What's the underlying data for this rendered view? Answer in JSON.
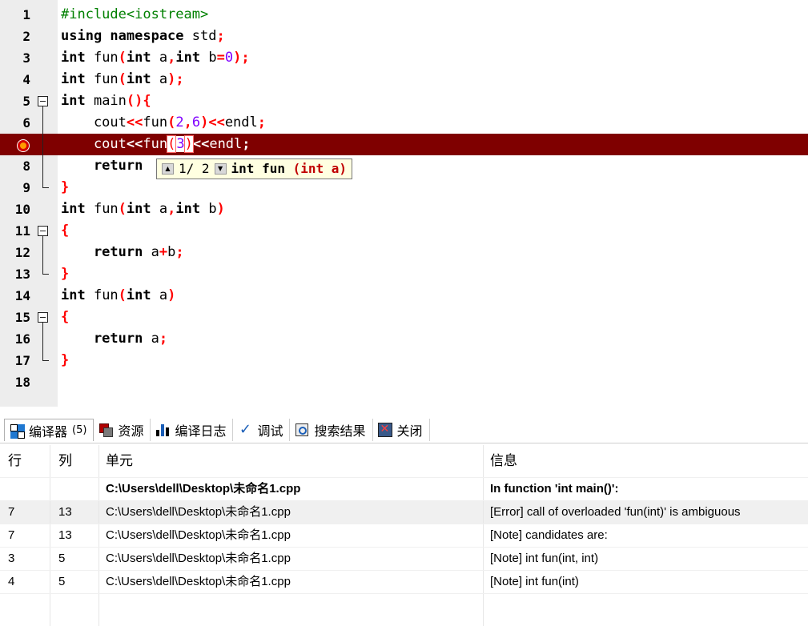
{
  "editor": {
    "lines": [
      {
        "num": "1",
        "fold": "",
        "tokens": [
          {
            "t": "#include<iostream>",
            "c": "pp"
          }
        ]
      },
      {
        "num": "2",
        "fold": "",
        "tokens": [
          {
            "t": "using namespace",
            "c": "kw"
          },
          {
            "t": " std",
            "c": ""
          },
          {
            "t": ";",
            "c": "sym"
          }
        ]
      },
      {
        "num": "3",
        "fold": "",
        "tokens": [
          {
            "t": "int",
            "c": "kw"
          },
          {
            "t": " fun",
            "c": ""
          },
          {
            "t": "(",
            "c": "sym"
          },
          {
            "t": "int",
            "c": "kw"
          },
          {
            "t": " a",
            "c": ""
          },
          {
            "t": ",",
            "c": "sym"
          },
          {
            "t": "int",
            "c": "kw"
          },
          {
            "t": " b",
            "c": ""
          },
          {
            "t": "=",
            "c": "sym"
          },
          {
            "t": "0",
            "c": "num"
          },
          {
            "t": ");",
            "c": "sym"
          }
        ]
      },
      {
        "num": "4",
        "fold": "",
        "tokens": [
          {
            "t": "int",
            "c": "kw"
          },
          {
            "t": " fun",
            "c": ""
          },
          {
            "t": "(",
            "c": "sym"
          },
          {
            "t": "int",
            "c": "kw"
          },
          {
            "t": " a",
            "c": ""
          },
          {
            "t": ");",
            "c": "sym"
          }
        ]
      },
      {
        "num": "5",
        "fold": "start",
        "tokens": [
          {
            "t": "int",
            "c": "kw"
          },
          {
            "t": " main",
            "c": ""
          },
          {
            "t": "(){",
            "c": "sym"
          }
        ]
      },
      {
        "num": "6",
        "fold": "mid",
        "tokens": [
          {
            "t": "    cout",
            "c": ""
          },
          {
            "t": "<<",
            "c": "sym"
          },
          {
            "t": "fun",
            "c": ""
          },
          {
            "t": "(",
            "c": "sym"
          },
          {
            "t": "2",
            "c": "num"
          },
          {
            "t": ",",
            "c": "sym"
          },
          {
            "t": "6",
            "c": "num"
          },
          {
            "t": ")<<",
            "c": "sym"
          },
          {
            "t": "endl",
            "c": ""
          },
          {
            "t": ";",
            "c": "sym"
          }
        ]
      },
      {
        "num": "7",
        "fold": "mid",
        "breakpoint": true,
        "tokens": [
          {
            "t": "    cout",
            "c": ""
          },
          {
            "t": "<<",
            "c": "sym"
          },
          {
            "t": "fun",
            "c": ""
          },
          {
            "t": "(",
            "c": "hl-br"
          },
          {
            "t": "3",
            "c": "cursor"
          },
          {
            "t": ")",
            "c": "hl-br"
          },
          {
            "t": "<<",
            "c": "sym"
          },
          {
            "t": "endl",
            "c": ""
          },
          {
            "t": ";",
            "c": "sym"
          }
        ]
      },
      {
        "num": "8",
        "fold": "mid",
        "tokens": [
          {
            "t": "    return",
            "c": "kw"
          }
        ]
      },
      {
        "num": "9",
        "fold": "end",
        "tokens": [
          {
            "t": "}",
            "c": "sym"
          }
        ]
      },
      {
        "num": "10",
        "fold": "",
        "tokens": [
          {
            "t": "int",
            "c": "kw"
          },
          {
            "t": " fun",
            "c": ""
          },
          {
            "t": "(",
            "c": "sym"
          },
          {
            "t": "int",
            "c": "kw"
          },
          {
            "t": " a",
            "c": ""
          },
          {
            "t": ",",
            "c": "sym"
          },
          {
            "t": "int",
            "c": "kw"
          },
          {
            "t": " b",
            "c": ""
          },
          {
            "t": ")",
            "c": "sym"
          }
        ]
      },
      {
        "num": "11",
        "fold": "start",
        "tokens": [
          {
            "t": "{",
            "c": "sym"
          }
        ]
      },
      {
        "num": "12",
        "fold": "mid",
        "tokens": [
          {
            "t": "    return",
            "c": "kw"
          },
          {
            "t": " a",
            "c": ""
          },
          {
            "t": "+",
            "c": "sym"
          },
          {
            "t": "b",
            "c": ""
          },
          {
            "t": ";",
            "c": "sym"
          }
        ]
      },
      {
        "num": "13",
        "fold": "end",
        "tokens": [
          {
            "t": "}",
            "c": "sym"
          }
        ]
      },
      {
        "num": "14",
        "fold": "",
        "tokens": [
          {
            "t": "int",
            "c": "kw"
          },
          {
            "t": " fun",
            "c": ""
          },
          {
            "t": "(",
            "c": "sym"
          },
          {
            "t": "int",
            "c": "kw"
          },
          {
            "t": " a",
            "c": ""
          },
          {
            "t": ")",
            "c": "sym"
          }
        ]
      },
      {
        "num": "15",
        "fold": "start",
        "tokens": [
          {
            "t": "{",
            "c": "sym"
          }
        ]
      },
      {
        "num": "16",
        "fold": "mid",
        "tokens": [
          {
            "t": "    return",
            "c": "kw"
          },
          {
            "t": " a",
            "c": ""
          },
          {
            "t": ";",
            "c": "sym"
          }
        ]
      },
      {
        "num": "17",
        "fold": "end",
        "tokens": [
          {
            "t": "}",
            "c": "sym"
          }
        ]
      },
      {
        "num": "18",
        "fold": "",
        "tokens": []
      }
    ],
    "tooltip": {
      "counter": "1/ 2",
      "sig_type": "int fun ",
      "sig_params": "(int a)"
    }
  },
  "tabs": [
    {
      "label": "编译器",
      "count": "(5)",
      "icon": "compiler-grid-icon"
    },
    {
      "label": "资源",
      "count": "",
      "icon": "resources-icon"
    },
    {
      "label": "编译日志",
      "count": "",
      "icon": "compile-log-bars-icon"
    },
    {
      "label": "调试",
      "count": "",
      "icon": "debug-check-icon"
    },
    {
      "label": "搜索结果",
      "count": "",
      "icon": "search-results-icon"
    },
    {
      "label": "关闭",
      "count": "",
      "icon": "close-panel-icon"
    }
  ],
  "compiler": {
    "headers": {
      "line": "行",
      "col": "列",
      "unit": "单元",
      "info": "信息"
    },
    "rows": [
      {
        "line": "",
        "col": "",
        "unit": "C:\\Users\\dell\\Desktop\\未命名1.cpp",
        "info": "In function 'int main()':",
        "bold": true
      },
      {
        "line": "7",
        "col": "13",
        "unit": "C:\\Users\\dell\\Desktop\\未命名1.cpp",
        "info": "[Error] call of overloaded 'fun(int)' is ambiguous",
        "selected": true
      },
      {
        "line": "7",
        "col": "13",
        "unit": "C:\\Users\\dell\\Desktop\\未命名1.cpp",
        "info": "[Note] candidates are:"
      },
      {
        "line": "3",
        "col": "5",
        "unit": "C:\\Users\\dell\\Desktop\\未命名1.cpp",
        "info": "[Note] int fun(int, int)"
      },
      {
        "line": "4",
        "col": "5",
        "unit": "C:\\Users\\dell\\Desktop\\未命名1.cpp",
        "info": "[Note] int fun(int)"
      }
    ]
  },
  "colors": {
    "breakpoint_line": "#7f0000",
    "keyword": "#000000",
    "preprocessor": "#008000",
    "symbol": "#ff0000",
    "number": "#8000ff"
  }
}
